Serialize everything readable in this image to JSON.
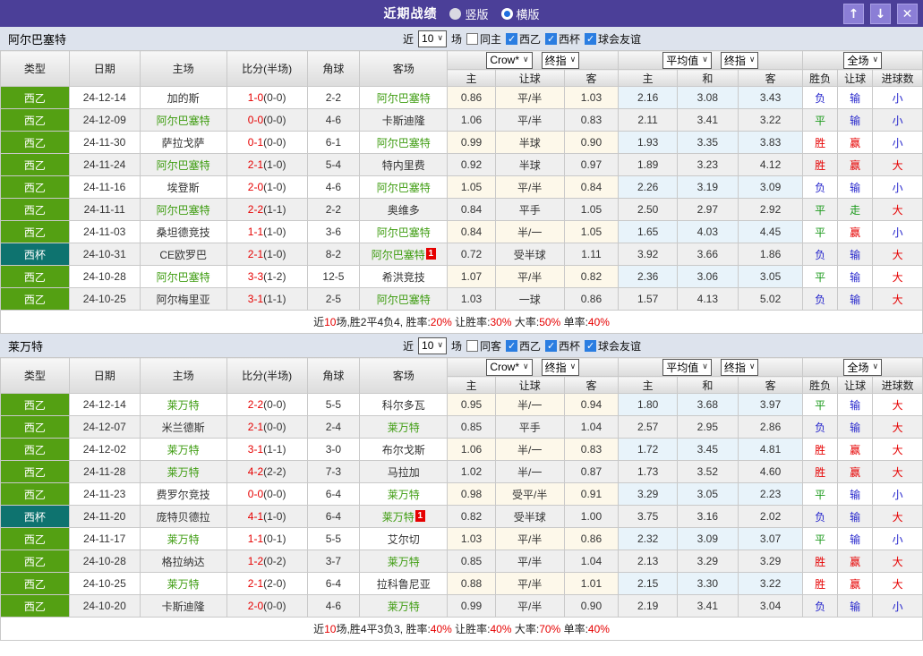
{
  "titlebar": {
    "title": "近期战绩",
    "radio_vertical": "竖版",
    "radio_horizontal": "横版",
    "radio_selected": "横版",
    "btn_up": "↑",
    "btn_down": "↓",
    "btn_close": "✕"
  },
  "colors": {
    "titlebar_purple": "#4b3f98",
    "titlebar_button": "#8b7ed6",
    "section_bar": "#dde3ed",
    "league_green": "#54a013",
    "cup_teal": "#0e736f",
    "red": "#e60000",
    "blue": "#2626cc",
    "result_green": "#1d9b1d",
    "team_green": "#3e9c10",
    "crow_bg": "#fdf8ea",
    "avg_bg": "#e8f3fa",
    "stripe_gray": "#efefef"
  },
  "sections": [
    {
      "team": "阿尔巴塞特",
      "filter": {
        "near": "近",
        "count": "10",
        "games": "场",
        "same": {
          "label": "同主",
          "checked": false
        },
        "comps": [
          {
            "label": "西乙",
            "checked": true
          },
          {
            "label": "西杯",
            "checked": true
          },
          {
            "label": "球会友谊",
            "checked": true
          }
        ]
      },
      "columns": {
        "left": [
          "类型",
          "日期",
          "主场",
          "比分(半场)",
          "角球",
          "客场"
        ],
        "crow_selects": [
          "Crow*",
          "终指"
        ],
        "crow_cols": [
          "主",
          "让球",
          "客"
        ],
        "avg_selects": [
          "平均值",
          "终指"
        ],
        "avg_cols": [
          "主",
          "和",
          "客"
        ],
        "full_select": "全场",
        "result_cols": [
          "胜负",
          "让球",
          "进球数"
        ]
      },
      "rows": [
        {
          "comp": "西乙",
          "comp_style": "green",
          "date": "24-12-14",
          "home": "加的斯",
          "home_self": false,
          "home_badge": "",
          "score": "1-0",
          "half": "(0-0)",
          "corners": "2-2",
          "away": "阿尔巴塞特",
          "away_self": true,
          "away_badge": "",
          "crow": [
            "0.86",
            "平/半",
            "1.03"
          ],
          "avg": [
            "2.16",
            "3.08",
            "3.43"
          ],
          "results": [
            [
              "负",
              "blue"
            ],
            [
              "输",
              "blue"
            ],
            [
              "小",
              "blue"
            ]
          ]
        },
        {
          "comp": "西乙",
          "comp_style": "green",
          "date": "24-12-09",
          "home": "阿尔巴塞特",
          "home_self": true,
          "home_badge": "",
          "score": "0-0",
          "half": "(0-0)",
          "corners": "4-6",
          "away": "卡斯迪隆",
          "away_self": false,
          "away_badge": "",
          "crow": [
            "1.06",
            "平/半",
            "0.83"
          ],
          "avg": [
            "2.11",
            "3.41",
            "3.22"
          ],
          "results": [
            [
              "平",
              "green"
            ],
            [
              "输",
              "blue"
            ],
            [
              "小",
              "blue"
            ]
          ]
        },
        {
          "comp": "西乙",
          "comp_style": "green",
          "date": "24-11-30",
          "home": "萨拉戈萨",
          "home_self": false,
          "home_badge": "",
          "score": "0-1",
          "half": "(0-0)",
          "corners": "6-1",
          "away": "阿尔巴塞特",
          "away_self": true,
          "away_badge": "",
          "crow": [
            "0.99",
            "半球",
            "0.90"
          ],
          "avg": [
            "1.93",
            "3.35",
            "3.83"
          ],
          "results": [
            [
              "胜",
              "red"
            ],
            [
              "赢",
              "red"
            ],
            [
              "小",
              "blue"
            ]
          ]
        },
        {
          "comp": "西乙",
          "comp_style": "green",
          "date": "24-11-24",
          "home": "阿尔巴塞特",
          "home_self": true,
          "home_badge": "",
          "score": "2-1",
          "half": "(1-0)",
          "corners": "5-4",
          "away": "特内里费",
          "away_self": false,
          "away_badge": "",
          "crow": [
            "0.92",
            "半球",
            "0.97"
          ],
          "avg": [
            "1.89",
            "3.23",
            "4.12"
          ],
          "results": [
            [
              "胜",
              "red"
            ],
            [
              "赢",
              "red"
            ],
            [
              "大",
              "red"
            ]
          ]
        },
        {
          "comp": "西乙",
          "comp_style": "green",
          "date": "24-11-16",
          "home": "埃登斯",
          "home_self": false,
          "home_badge": "",
          "score": "2-0",
          "half": "(1-0)",
          "corners": "4-6",
          "away": "阿尔巴塞特",
          "away_self": true,
          "away_badge": "",
          "crow": [
            "1.05",
            "平/半",
            "0.84"
          ],
          "avg": [
            "2.26",
            "3.19",
            "3.09"
          ],
          "results": [
            [
              "负",
              "blue"
            ],
            [
              "输",
              "blue"
            ],
            [
              "小",
              "blue"
            ]
          ]
        },
        {
          "comp": "西乙",
          "comp_style": "green",
          "date": "24-11-11",
          "home": "阿尔巴塞特",
          "home_self": true,
          "home_badge": "",
          "score": "2-2",
          "half": "(1-1)",
          "corners": "2-2",
          "away": "奥维多",
          "away_self": false,
          "away_badge": "",
          "crow": [
            "0.84",
            "平手",
            "1.05"
          ],
          "avg": [
            "2.50",
            "2.97",
            "2.92"
          ],
          "results": [
            [
              "平",
              "green"
            ],
            [
              "走",
              "green"
            ],
            [
              "大",
              "red"
            ]
          ]
        },
        {
          "comp": "西乙",
          "comp_style": "green",
          "date": "24-11-03",
          "home": "桑坦德竞技",
          "home_self": false,
          "home_badge": "",
          "score": "1-1",
          "half": "(1-0)",
          "corners": "3-6",
          "away": "阿尔巴塞特",
          "away_self": true,
          "away_badge": "",
          "crow": [
            "0.84",
            "半/一",
            "1.05"
          ],
          "avg": [
            "1.65",
            "4.03",
            "4.45"
          ],
          "results": [
            [
              "平",
              "green"
            ],
            [
              "赢",
              "red"
            ],
            [
              "小",
              "blue"
            ]
          ]
        },
        {
          "comp": "西杯",
          "comp_style": "teal",
          "date": "24-10-31",
          "home": "CE欧罗巴",
          "home_self": false,
          "home_badge": "",
          "score": "2-1",
          "half": "(1-0)",
          "corners": "8-2",
          "away": "阿尔巴塞特",
          "away_self": true,
          "away_badge": "1",
          "crow": [
            "0.72",
            "受半球",
            "1.11"
          ],
          "avg": [
            "3.92",
            "3.66",
            "1.86"
          ],
          "results": [
            [
              "负",
              "blue"
            ],
            [
              "输",
              "blue"
            ],
            [
              "大",
              "red"
            ]
          ]
        },
        {
          "comp": "西乙",
          "comp_style": "green",
          "date": "24-10-28",
          "home": "阿尔巴塞特",
          "home_self": true,
          "home_badge": "",
          "score": "3-3",
          "half": "(1-2)",
          "corners": "12-5",
          "away": "希洪竞技",
          "away_self": false,
          "away_badge": "",
          "crow": [
            "1.07",
            "平/半",
            "0.82"
          ],
          "avg": [
            "2.36",
            "3.06",
            "3.05"
          ],
          "results": [
            [
              "平",
              "green"
            ],
            [
              "输",
              "blue"
            ],
            [
              "大",
              "red"
            ]
          ]
        },
        {
          "comp": "西乙",
          "comp_style": "green",
          "date": "24-10-25",
          "home": "阿尔梅里亚",
          "home_self": false,
          "home_badge": "",
          "score": "3-1",
          "half": "(1-1)",
          "corners": "2-5",
          "away": "阿尔巴塞特",
          "away_self": true,
          "away_badge": "",
          "crow": [
            "1.03",
            "一球",
            "0.86"
          ],
          "avg": [
            "1.57",
            "4.13",
            "5.02"
          ],
          "results": [
            [
              "负",
              "blue"
            ],
            [
              "输",
              "blue"
            ],
            [
              "大",
              "red"
            ]
          ]
        }
      ],
      "summary": [
        {
          "t": "近",
          "red": false
        },
        {
          "t": "10",
          "red": true
        },
        {
          "t": "场,胜2平4负4, 胜率:",
          "red": false
        },
        {
          "t": "20%",
          "red": true
        },
        {
          "t": " 让胜率:",
          "red": false
        },
        {
          "t": "30%",
          "red": true
        },
        {
          "t": " 大率:",
          "red": false
        },
        {
          "t": "50%",
          "red": true
        },
        {
          "t": " 单率:",
          "red": false
        },
        {
          "t": "40%",
          "red": true
        }
      ]
    },
    {
      "team": "莱万特",
      "filter": {
        "near": "近",
        "count": "10",
        "games": "场",
        "same": {
          "label": "同客",
          "checked": false
        },
        "comps": [
          {
            "label": "西乙",
            "checked": true
          },
          {
            "label": "西杯",
            "checked": true
          },
          {
            "label": "球会友谊",
            "checked": true
          }
        ]
      },
      "columns": {
        "left": [
          "类型",
          "日期",
          "主场",
          "比分(半场)",
          "角球",
          "客场"
        ],
        "crow_selects": [
          "Crow*",
          "终指"
        ],
        "crow_cols": [
          "主",
          "让球",
          "客"
        ],
        "avg_selects": [
          "平均值",
          "终指"
        ],
        "avg_cols": [
          "主",
          "和",
          "客"
        ],
        "full_select": "全场",
        "result_cols": [
          "胜负",
          "让球",
          "进球数"
        ]
      },
      "rows": [
        {
          "comp": "西乙",
          "comp_style": "green",
          "date": "24-12-14",
          "home": "莱万特",
          "home_self": true,
          "home_badge": "",
          "score": "2-2",
          "half": "(0-0)",
          "corners": "5-5",
          "away": "科尔多瓦",
          "away_self": false,
          "away_badge": "",
          "crow": [
            "0.95",
            "半/一",
            "0.94"
          ],
          "avg": [
            "1.80",
            "3.68",
            "3.97"
          ],
          "results": [
            [
              "平",
              "green"
            ],
            [
              "输",
              "blue"
            ],
            [
              "大",
              "red"
            ]
          ]
        },
        {
          "comp": "西乙",
          "comp_style": "green",
          "date": "24-12-07",
          "home": "米兰德斯",
          "home_self": false,
          "home_badge": "",
          "score": "2-1",
          "half": "(0-0)",
          "corners": "2-4",
          "away": "莱万特",
          "away_self": true,
          "away_badge": "",
          "crow": [
            "0.85",
            "平手",
            "1.04"
          ],
          "avg": [
            "2.57",
            "2.95",
            "2.86"
          ],
          "results": [
            [
              "负",
              "blue"
            ],
            [
              "输",
              "blue"
            ],
            [
              "大",
              "red"
            ]
          ]
        },
        {
          "comp": "西乙",
          "comp_style": "green",
          "date": "24-12-02",
          "home": "莱万特",
          "home_self": true,
          "home_badge": "",
          "score": "3-1",
          "half": "(1-1)",
          "corners": "3-0",
          "away": "布尔戈斯",
          "away_self": false,
          "away_badge": "",
          "crow": [
            "1.06",
            "半/一",
            "0.83"
          ],
          "avg": [
            "1.72",
            "3.45",
            "4.81"
          ],
          "results": [
            [
              "胜",
              "red"
            ],
            [
              "赢",
              "red"
            ],
            [
              "大",
              "red"
            ]
          ]
        },
        {
          "comp": "西乙",
          "comp_style": "green",
          "date": "24-11-28",
          "home": "莱万特",
          "home_self": true,
          "home_badge": "",
          "score": "4-2",
          "half": "(2-2)",
          "corners": "7-3",
          "away": "马拉加",
          "away_self": false,
          "away_badge": "",
          "crow": [
            "1.02",
            "半/一",
            "0.87"
          ],
          "avg": [
            "1.73",
            "3.52",
            "4.60"
          ],
          "results": [
            [
              "胜",
              "red"
            ],
            [
              "赢",
              "red"
            ],
            [
              "大",
              "red"
            ]
          ]
        },
        {
          "comp": "西乙",
          "comp_style": "green",
          "date": "24-11-23",
          "home": "费罗尔竞技",
          "home_self": false,
          "home_badge": "",
          "score": "0-0",
          "half": "(0-0)",
          "corners": "6-4",
          "away": "莱万特",
          "away_self": true,
          "away_badge": "",
          "crow": [
            "0.98",
            "受平/半",
            "0.91"
          ],
          "avg": [
            "3.29",
            "3.05",
            "2.23"
          ],
          "results": [
            [
              "平",
              "green"
            ],
            [
              "输",
              "blue"
            ],
            [
              "小",
              "blue"
            ]
          ]
        },
        {
          "comp": "西杯",
          "comp_style": "teal",
          "date": "24-11-20",
          "home": "庞特贝德拉",
          "home_self": false,
          "home_badge": "",
          "score": "4-1",
          "half": "(1-0)",
          "corners": "6-4",
          "away": "莱万特",
          "away_self": true,
          "away_badge": "1",
          "crow": [
            "0.82",
            "受半球",
            "1.00"
          ],
          "avg": [
            "3.75",
            "3.16",
            "2.02"
          ],
          "results": [
            [
              "负",
              "blue"
            ],
            [
              "输",
              "blue"
            ],
            [
              "大",
              "red"
            ]
          ]
        },
        {
          "comp": "西乙",
          "comp_style": "green",
          "date": "24-11-17",
          "home": "莱万特",
          "home_self": true,
          "home_badge": "",
          "score": "1-1",
          "half": "(0-1)",
          "corners": "5-5",
          "away": "艾尔切",
          "away_self": false,
          "away_badge": "",
          "crow": [
            "1.03",
            "平/半",
            "0.86"
          ],
          "avg": [
            "2.32",
            "3.09",
            "3.07"
          ],
          "results": [
            [
              "平",
              "green"
            ],
            [
              "输",
              "blue"
            ],
            [
              "小",
              "blue"
            ]
          ]
        },
        {
          "comp": "西乙",
          "comp_style": "green",
          "date": "24-10-28",
          "home": "格拉纳达",
          "home_self": false,
          "home_badge": "",
          "score": "1-2",
          "half": "(0-2)",
          "corners": "3-7",
          "away": "莱万特",
          "away_self": true,
          "away_badge": "",
          "crow": [
            "0.85",
            "平/半",
            "1.04"
          ],
          "avg": [
            "2.13",
            "3.29",
            "3.29"
          ],
          "results": [
            [
              "胜",
              "red"
            ],
            [
              "赢",
              "red"
            ],
            [
              "大",
              "red"
            ]
          ]
        },
        {
          "comp": "西乙",
          "comp_style": "green",
          "date": "24-10-25",
          "home": "莱万特",
          "home_self": true,
          "home_badge": "",
          "score": "2-1",
          "half": "(2-0)",
          "corners": "6-4",
          "away": "拉科鲁尼亚",
          "away_self": false,
          "away_badge": "",
          "crow": [
            "0.88",
            "平/半",
            "1.01"
          ],
          "avg": [
            "2.15",
            "3.30",
            "3.22"
          ],
          "results": [
            [
              "胜",
              "red"
            ],
            [
              "赢",
              "red"
            ],
            [
              "大",
              "red"
            ]
          ]
        },
        {
          "comp": "西乙",
          "comp_style": "green",
          "date": "24-10-20",
          "home": "卡斯迪隆",
          "home_self": false,
          "home_badge": "",
          "score": "2-0",
          "half": "(0-0)",
          "corners": "4-6",
          "away": "莱万特",
          "away_self": true,
          "away_badge": "",
          "crow": [
            "0.99",
            "平/半",
            "0.90"
          ],
          "avg": [
            "2.19",
            "3.41",
            "3.04"
          ],
          "results": [
            [
              "负",
              "blue"
            ],
            [
              "输",
              "blue"
            ],
            [
              "小",
              "blue"
            ]
          ]
        }
      ],
      "summary": [
        {
          "t": "近",
          "red": false
        },
        {
          "t": "10",
          "red": true
        },
        {
          "t": "场,胜4平3负3, 胜率:",
          "red": false
        },
        {
          "t": "40%",
          "red": true
        },
        {
          "t": " 让胜率:",
          "red": false
        },
        {
          "t": "40%",
          "red": true
        },
        {
          "t": " 大率:",
          "red": false
        },
        {
          "t": "70%",
          "red": true
        },
        {
          "t": " 单率:",
          "red": false
        },
        {
          "t": "40%",
          "red": true
        }
      ]
    }
  ]
}
